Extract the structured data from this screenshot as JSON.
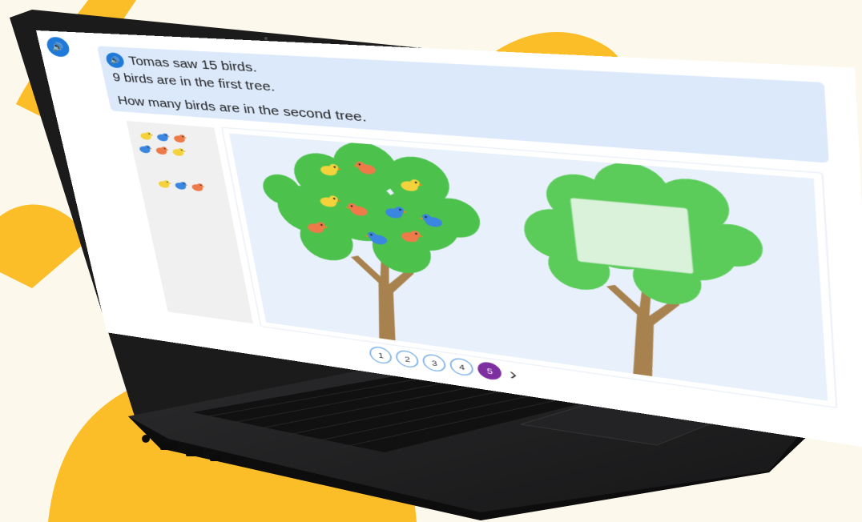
{
  "question": {
    "line1": "Tomas saw 15 birds.",
    "line2": "9 birds are in the first tree.",
    "line3": "How many birds are in the second tree."
  },
  "icons": {
    "speaker": "speaker-icon",
    "next": "chevron-right-icon"
  },
  "pagination": {
    "pages": [
      "1",
      "2",
      "3",
      "4",
      "5"
    ],
    "current": "5",
    "next": "›"
  },
  "colors": {
    "accent_blue": "#1f79d8",
    "question_bg": "#dbe9fb",
    "page_active": "#7e2f9f",
    "background_shape": "#fbbd28",
    "tree_green": "#4cc24c"
  }
}
